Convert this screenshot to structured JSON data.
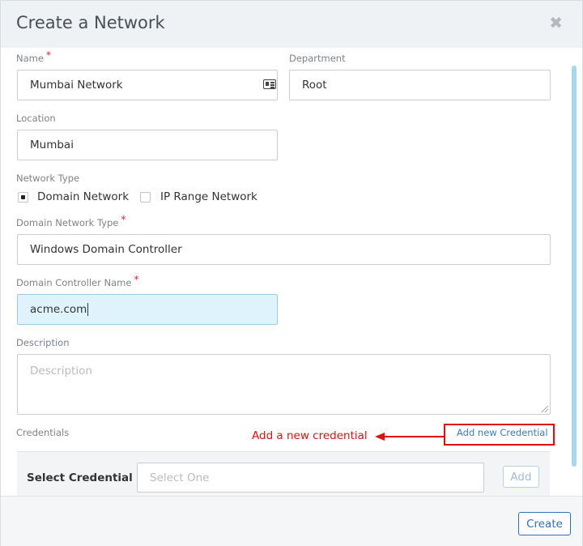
{
  "modal": {
    "title": "Create a Network",
    "close_glyph": "✖"
  },
  "fields": {
    "name": {
      "label": "Name",
      "required_mark": "*",
      "value": "Mumbai Network"
    },
    "department": {
      "label": "Department",
      "value": "Root"
    },
    "location": {
      "label": "Location",
      "value": "Mumbai"
    },
    "network_type": {
      "label": "Network Type",
      "options": [
        {
          "label": "Domain Network",
          "checked": true
        },
        {
          "label": "IP Range Network",
          "checked": false
        }
      ]
    },
    "domain_network_type": {
      "label": "Domain Network Type",
      "required_mark": "*",
      "value": "Windows Domain Controller"
    },
    "domain_controller_name": {
      "label": "Domain Controller Name",
      "required_mark": "*",
      "value": "acme.com"
    },
    "description": {
      "label": "Description",
      "placeholder": "Description"
    }
  },
  "credentials": {
    "label": "Credentials",
    "add_link": "Add new Credential",
    "annotation": "Add a new credential",
    "select_label": "Select Credential",
    "select_placeholder": "Select One",
    "add_button": "Add"
  },
  "footer": {
    "create_button": "Create"
  },
  "colors": {
    "accent": "#2f6fb8",
    "annotation": "#e01010",
    "focused_field": "#dff3fc",
    "header_bg": "#eef2f5"
  },
  "icons": {
    "name_field_icon": "id-card-icon",
    "close": "close-icon"
  }
}
